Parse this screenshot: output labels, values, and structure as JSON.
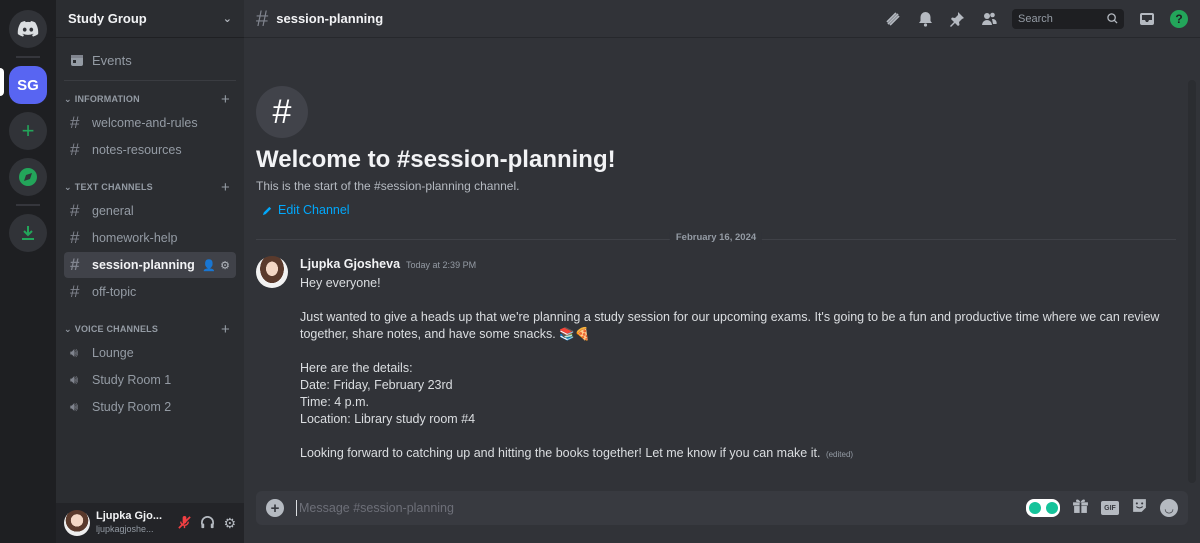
{
  "servers": {
    "home_icon": "discord-icon",
    "active_server": "SG",
    "add_server_icon": "plus-icon",
    "discover_icon": "compass-icon",
    "download_icon": "download-icon"
  },
  "sidebar": {
    "server_name": "Study Group",
    "events_label": "Events",
    "categories": [
      {
        "name": "INFORMATION",
        "channels": [
          {
            "label": "welcome-and-rules",
            "type": "text"
          },
          {
            "label": "notes-resources",
            "type": "text"
          }
        ]
      },
      {
        "name": "TEXT CHANNELS",
        "channels": [
          {
            "label": "general",
            "type": "text"
          },
          {
            "label": "homework-help",
            "type": "text"
          },
          {
            "label": "session-planning",
            "type": "text",
            "active": true
          },
          {
            "label": "off-topic",
            "type": "text"
          }
        ]
      },
      {
        "name": "VOICE CHANNELS",
        "channels": [
          {
            "label": "Lounge",
            "type": "voice"
          },
          {
            "label": "Study Room 1",
            "type": "voice"
          },
          {
            "label": "Study Room 2",
            "type": "voice"
          }
        ]
      }
    ],
    "user": {
      "display_name": "Ljupka Gjo...",
      "username": "ljupkagjoshe..."
    }
  },
  "header": {
    "channel_name": "session-planning",
    "search_placeholder": "Search",
    "icons": [
      "threads-icon",
      "bell-icon",
      "pin-icon",
      "members-icon",
      "inbox-icon",
      "help-icon"
    ]
  },
  "welcome": {
    "title": "Welcome to #session-planning!",
    "subtitle": "This is the start of the #session-planning channel.",
    "edit_label": "Edit Channel"
  },
  "date_divider": "February 16, 2024",
  "message": {
    "author": "Ljupka Gjosheva",
    "timestamp": "Today at 2:39 PM",
    "lines": [
      "Hey everyone!",
      "",
      "Just wanted to give a heads up that we're planning a study session for our upcoming exams. It's going to be a fun and productive time where we can review",
      "together, share notes, and have some snacks. 📚🍕",
      "",
      "Here are the details:",
      "Date: Friday, February 23rd",
      "Time: 4 p.m.",
      "Location: Library study room #4",
      "",
      "Looking forward to catching up and hitting the books together! Let me know if you can make it."
    ],
    "edited_label": "(edited)"
  },
  "composer": {
    "placeholder": "Message #session-planning",
    "value": ""
  }
}
